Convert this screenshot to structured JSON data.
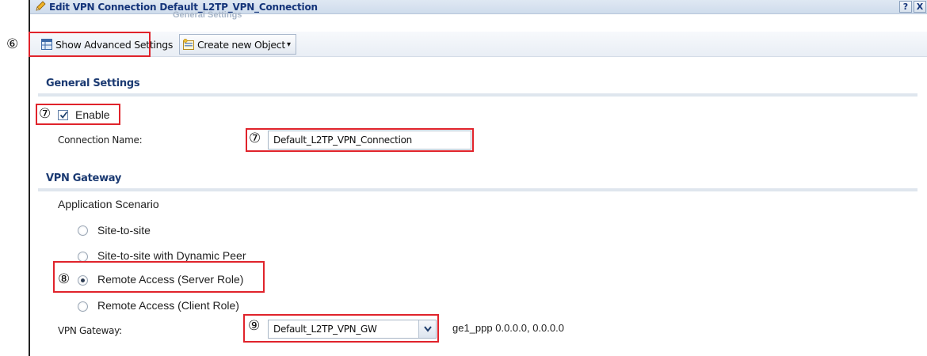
{
  "window": {
    "title": "Edit VPN Connection Default_L2TP_VPN_Connection",
    "ghost_title": "General Settings",
    "help_label": "?",
    "close_label": "X"
  },
  "toolbar": {
    "advanced_label": "Show Advanced Settings",
    "create_label": "Create new Object",
    "create_arrow": "▾"
  },
  "general": {
    "title": "General Settings",
    "enable_label": "Enable",
    "enable_checked": true,
    "connection_name_label": "Connection Name:",
    "connection_name_value": "Default_L2TP_VPN_Connection"
  },
  "gateway": {
    "title": "VPN Gateway",
    "scenario_label": "Application Scenario",
    "options": [
      "Site-to-site",
      "Site-to-site with Dynamic Peer",
      "Remote Access (Server Role)",
      "Remote Access (Client Role)"
    ],
    "selected_option": "Remote Access (Server Role)",
    "gateway_label": "VPN Gateway:",
    "gateway_value": "Default_L2TP_VPN_GW",
    "gateway_info": "ge1_ppp  0.0.0.0, 0.0.0.0"
  },
  "annotations": {
    "n6": "⑥",
    "n7a": "⑦",
    "n7b": "⑦",
    "n8": "⑧",
    "n9": "⑨"
  },
  "colors": {
    "annotation_red": "#e0232b",
    "section_title": "#1b3a72",
    "title_text": "#15357a"
  }
}
